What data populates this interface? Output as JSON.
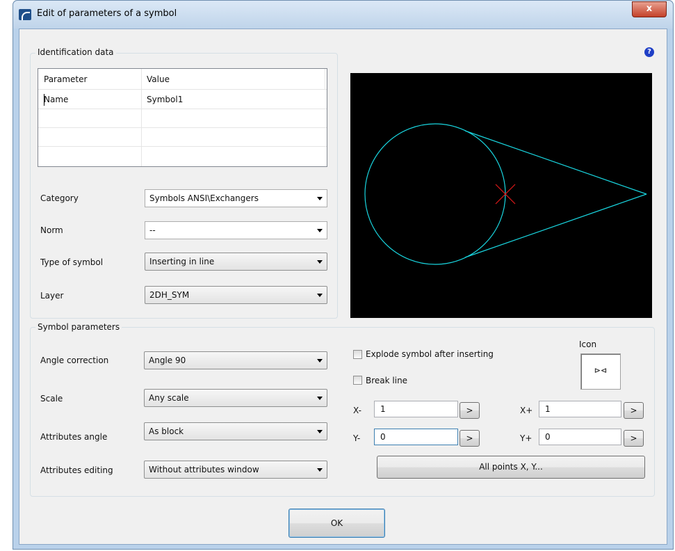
{
  "window": {
    "title": "Edit of parameters of a symbol",
    "close_label": "x"
  },
  "help": {
    "label": "?"
  },
  "identification": {
    "legend": "Identification data",
    "table": {
      "headers": [
        "Parameter",
        "Value"
      ],
      "rows": [
        [
          "Name",
          "Symbol1"
        ]
      ]
    }
  },
  "fields": {
    "category": {
      "label": "Category",
      "value": "Symbols ANSI\\Exchangers"
    },
    "norm": {
      "label": "Norm",
      "value": "--"
    },
    "type": {
      "label": "Type of symbol",
      "value": "Inserting in line"
    },
    "layer": {
      "label": "Layer",
      "value": "2DH_SYM"
    }
  },
  "symbol_params": {
    "legend": "Symbol parameters",
    "angle_correction": {
      "label": "Angle correction",
      "value": "Angle 90"
    },
    "scale": {
      "label": "Scale",
      "value": "Any scale"
    },
    "attributes_angle": {
      "label": "Attributes angle",
      "value": "As block"
    },
    "attributes_editing": {
      "label": "Attributes editing",
      "value": "Without attributes window"
    }
  },
  "options": {
    "explode": {
      "label": "Explode symbol after inserting",
      "checked": false
    },
    "break_line": {
      "label": "Break line",
      "checked": false
    }
  },
  "icon": {
    "label": "Icon",
    "glyph": "⊳⊲"
  },
  "points": {
    "x_minus": {
      "label": "X-",
      "value": "1"
    },
    "y_minus": {
      "label": "Y-",
      "value": "0"
    },
    "x_plus": {
      "label": "X+",
      "value": "1"
    },
    "y_plus": {
      "label": "Y+",
      "value": "0"
    },
    "arrow_label": ">",
    "all_points_label": "All points X, Y..."
  },
  "preview": {
    "background": "#000000",
    "stroke": "#19d6e0",
    "marker": "#e01919"
  },
  "ok_label": "OK"
}
